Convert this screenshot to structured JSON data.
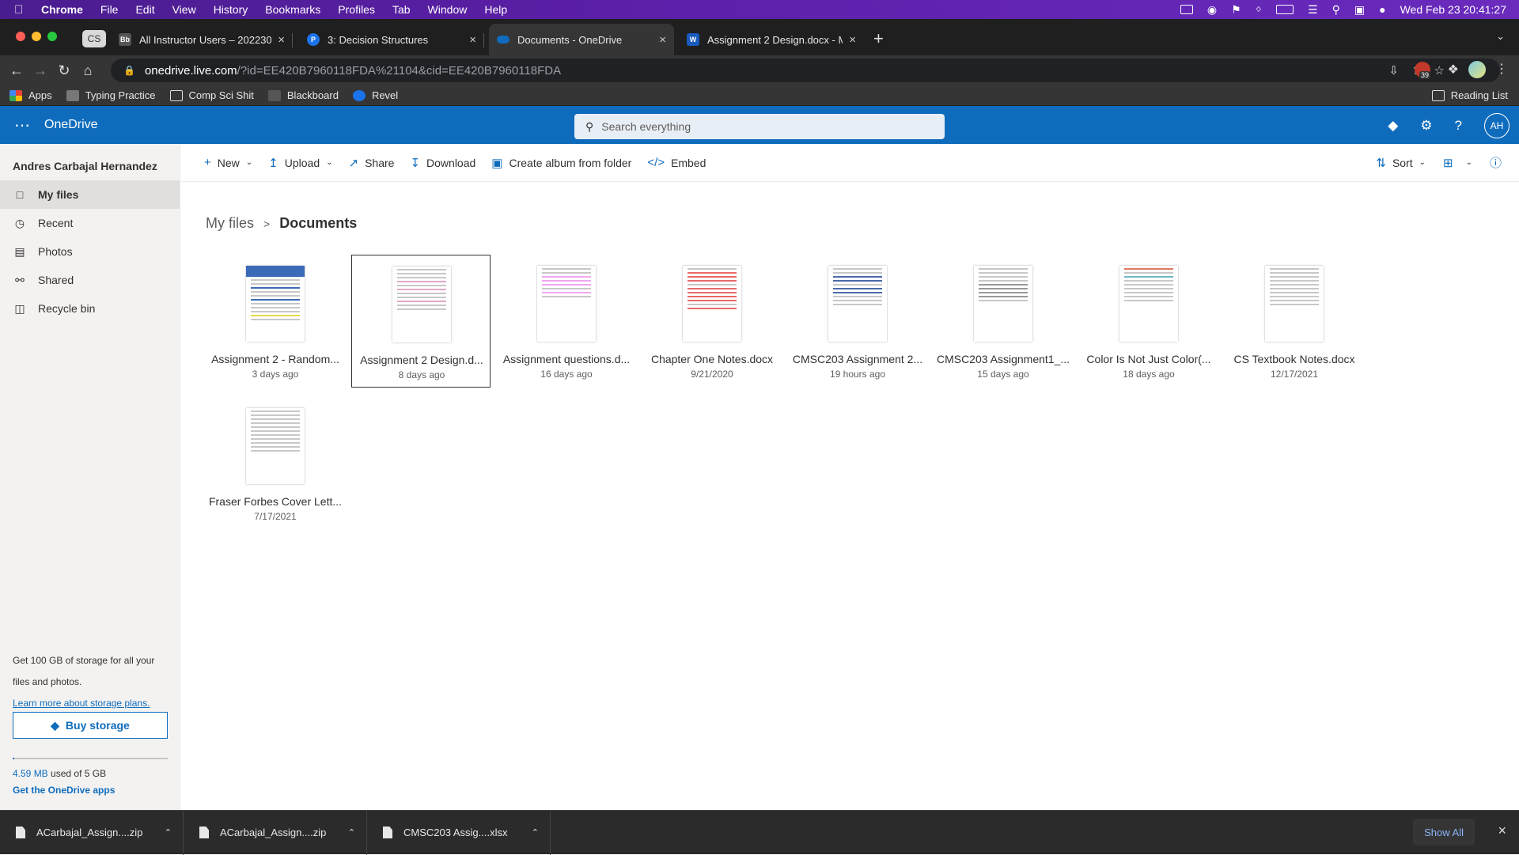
{
  "menubar": {
    "app": "Chrome",
    "items": [
      "File",
      "Edit",
      "View",
      "History",
      "Bookmarks",
      "Profiles",
      "Tab",
      "Window",
      "Help"
    ],
    "datetime": "Wed Feb 23  20:41:27"
  },
  "tabs": [
    {
      "label": "All Instructor Users – 202230",
      "favicon": "Bb"
    },
    {
      "label": "3: Decision Structures",
      "favicon": "P"
    },
    {
      "label": "Documents - OneDrive",
      "favicon": "cloud"
    },
    {
      "label": "Assignment 2 Design.docx - M",
      "favicon": "W"
    }
  ],
  "profile_chip": "CS",
  "address": {
    "host": "onedrive.live.com",
    "path": "/?id=EE420B7960118FDA%21104&cid=EE420B7960118FDA"
  },
  "extension_badge": "39",
  "bookmarks": {
    "items": [
      "Apps",
      "Typing Practice",
      "Comp Sci Shit",
      "Blackboard",
      "Revel"
    ],
    "reading_list": "Reading List"
  },
  "onedrive": {
    "brand": "OneDrive",
    "search_placeholder": "Search everything",
    "avatar": "AH"
  },
  "sidebar": {
    "user": "Andres Carbajal Hernandez",
    "items": [
      {
        "label": "My files",
        "icon": "folder-icon"
      },
      {
        "label": "Recent",
        "icon": "clock-icon"
      },
      {
        "label": "Photos",
        "icon": "image-icon"
      },
      {
        "label": "Shared",
        "icon": "people-icon"
      },
      {
        "label": "Recycle bin",
        "icon": "trash-icon"
      }
    ],
    "promo_line1": "Get 100 GB of storage for all your",
    "promo_line2": "files and photos.",
    "promo_link": "Learn more about storage plans.",
    "buy_label": "Buy storage",
    "usage_used": "4.59 MB",
    "usage_rest": " used of 5 GB",
    "quota_fraction": 0.001,
    "get_apps": "Get the OneDrive apps"
  },
  "commands": {
    "new": "New",
    "upload": "Upload",
    "share": "Share",
    "download": "Download",
    "create_album": "Create album from folder",
    "embed": "Embed",
    "sort": "Sort"
  },
  "breadcrumb": {
    "root": "My files",
    "current": "Documents"
  },
  "files": [
    {
      "name": "Assignment 2 - Random...",
      "date": "3 days ago"
    },
    {
      "name": "Assignment 2 Design.d...",
      "date": "8 days ago"
    },
    {
      "name": "Assignment questions.d...",
      "date": "16 days ago"
    },
    {
      "name": "Chapter One Notes.docx",
      "date": "9/21/2020"
    },
    {
      "name": "CMSC203 Assignment 2...",
      "date": "19 hours ago"
    },
    {
      "name": "CMSC203 Assignment1_...",
      "date": "15 days ago"
    },
    {
      "name": "Color Is Not Just Color(...",
      "date": "18 days ago"
    },
    {
      "name": "CS Textbook Notes.docx",
      "date": "12/17/2021"
    },
    {
      "name": "Fraser Forbes Cover Lett...",
      "date": "7/17/2021"
    }
  ],
  "downloads": {
    "items": [
      "ACarbajal_Assign....zip",
      "ACarbajal_Assign....zip",
      "CMSC203 Assig....xlsx"
    ],
    "show_all": "Show All"
  }
}
